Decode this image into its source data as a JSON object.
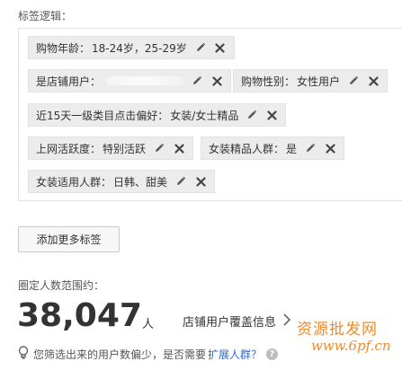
{
  "section_title": "标签逻辑：",
  "tags": [
    {
      "label": "购物年龄：",
      "value": "18-24岁，25-29岁"
    },
    {
      "label": "是店铺用户：",
      "value": ""
    },
    {
      "label": "购物性别：",
      "value": "女性用户"
    },
    {
      "label": "近15天一级类目点击偏好：",
      "value": "女装/女士精品"
    },
    {
      "label": "上网活跃度：",
      "value": "特别活跃"
    },
    {
      "label": "女装精品人群：",
      "value": "是"
    },
    {
      "label": "女装适用人群：",
      "value": "日韩、甜美"
    }
  ],
  "add_button": "添加更多标签",
  "range_label": "圈定人数范围约：",
  "count": "38,047",
  "unit": "人",
  "coverage_link": "店铺用户覆盖信息",
  "hint": {
    "text": "您筛选出来的用户数偏少，是否需要",
    "link": "扩展人群？",
    "help": "?"
  },
  "watermark": {
    "text": "资源批发网",
    "url": "www.6pf.cn"
  },
  "icons": {
    "edit": "pencil-icon",
    "remove": "close-icon",
    "hint": "lightbulb-icon",
    "link_arrow": "chevron-right-icon"
  },
  "colors": {
    "tag_bg": "#ececec",
    "link": "#2a6ad6",
    "watermark": "#f08a2b"
  }
}
